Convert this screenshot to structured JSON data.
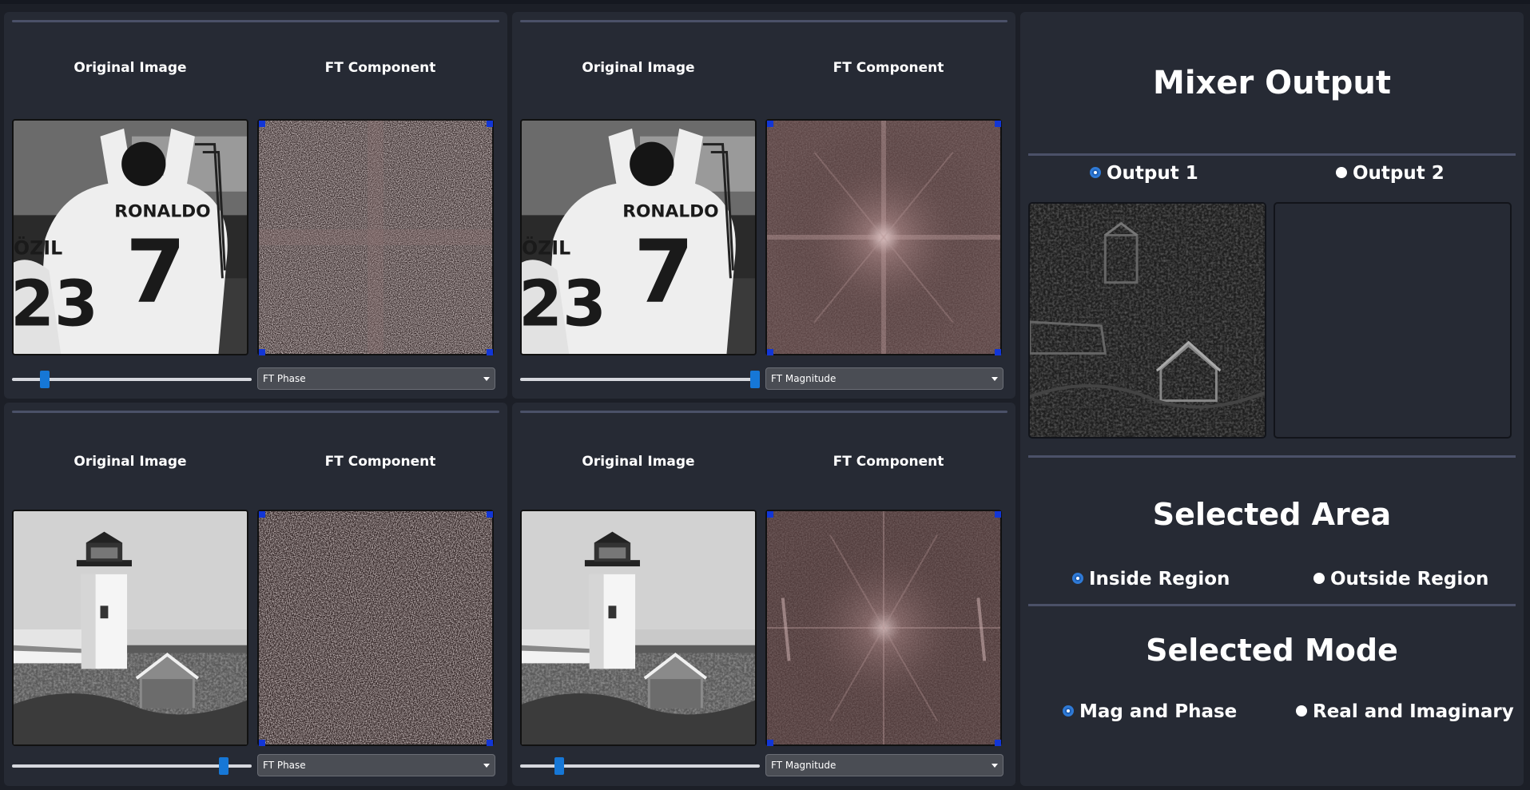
{
  "viewers": [
    {
      "original_label": "Original Image",
      "component_label": "FT Component",
      "original_image": "ronaldo-photo",
      "component_image": "ft-phase-pattern",
      "slider_percent": 12,
      "component_selected": "FT Phase"
    },
    {
      "original_label": "Original Image",
      "component_label": "FT Component",
      "original_image": "ronaldo-photo",
      "component_image": "ft-magnitude-spectrum",
      "slider_percent": 100,
      "component_selected": "FT Magnitude"
    },
    {
      "original_label": "Original Image",
      "component_label": "FT Component",
      "original_image": "lighthouse-photo",
      "component_image": "ft-phase-pattern",
      "slider_percent": 90,
      "component_selected": "FT Phase"
    },
    {
      "original_label": "Original Image",
      "component_label": "FT Component",
      "original_image": "lighthouse-photo",
      "component_image": "ft-magnitude-spectrum",
      "slider_percent": 15,
      "component_selected": "FT Magnitude"
    }
  ],
  "mixer": {
    "title": "Mixer Output",
    "outputs": [
      {
        "label": "Output 1",
        "checked": true
      },
      {
        "label": "Output 2",
        "checked": false
      }
    ],
    "output1_image": "mixed-lighthouse-output",
    "area": {
      "title": "Selected Area",
      "options": [
        {
          "label": "Inside Region",
          "checked": true
        },
        {
          "label": "Outside Region",
          "checked": false
        }
      ]
    },
    "mode": {
      "title": "Selected Mode",
      "options": [
        {
          "label": "Mag and Phase",
          "checked": true
        },
        {
          "label": "Real and Imaginary",
          "checked": false
        }
      ]
    }
  },
  "colors": {
    "background": "#1c1f27",
    "panel": "#262a34",
    "accent": "#1677d6",
    "separator": "#4b5168",
    "handle": "#1236d6"
  }
}
